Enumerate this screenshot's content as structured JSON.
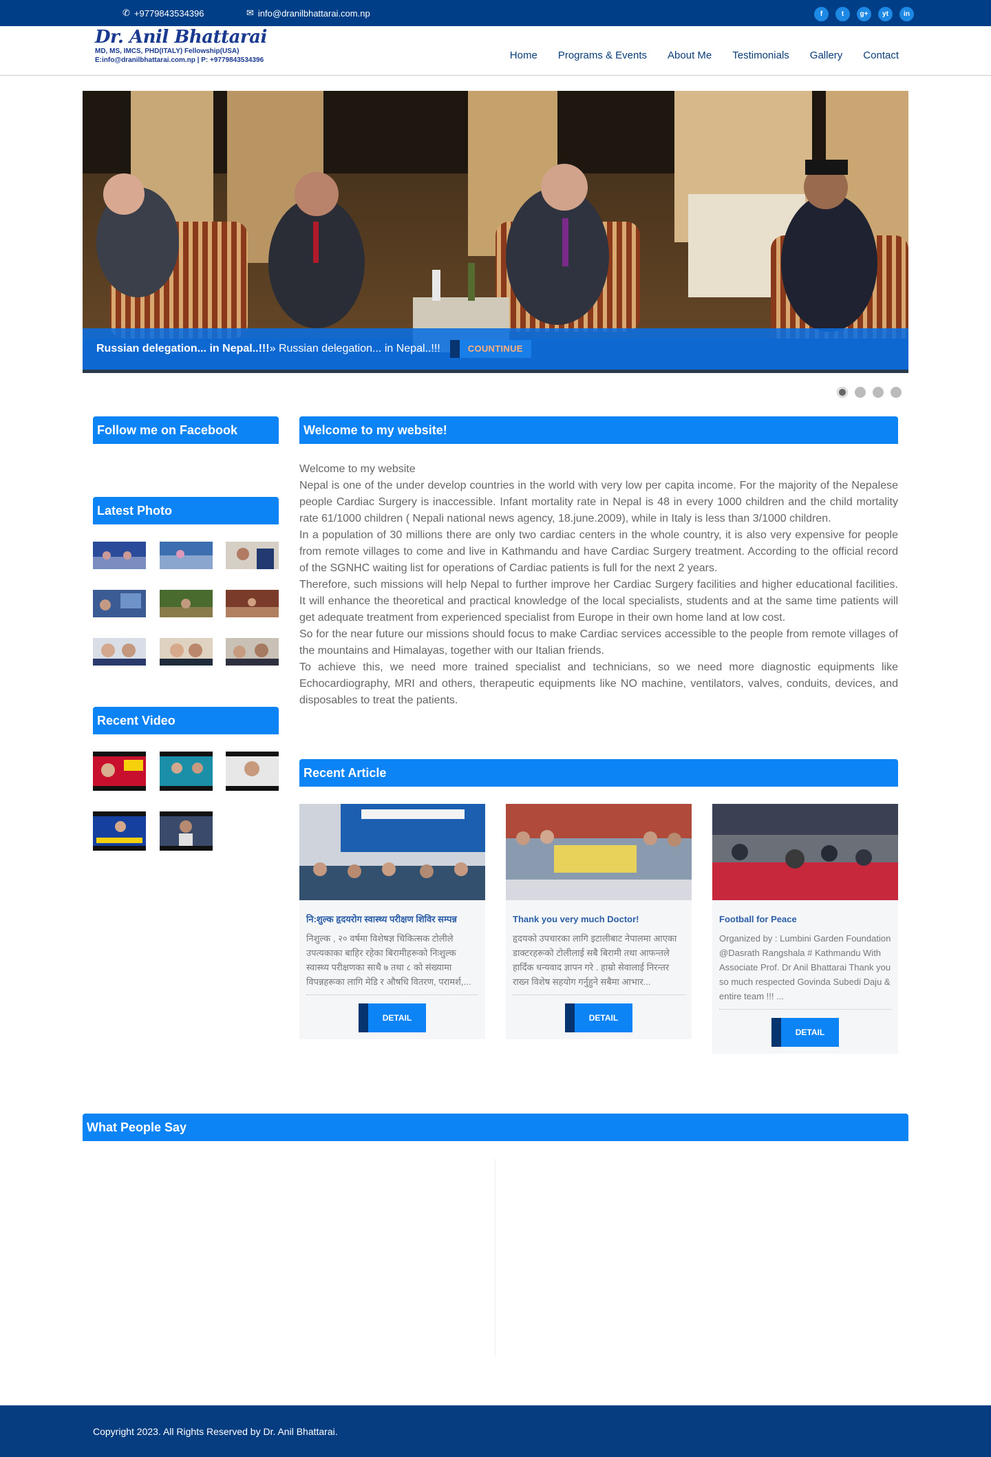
{
  "topbar": {
    "phone": "+9779843534396",
    "email": "info@dranilbhattarai.com.np",
    "social": [
      "f",
      "t",
      "g+",
      "yt",
      "in"
    ]
  },
  "logo": {
    "name": "Dr. Anil Bhattarai",
    "credentials": "MD, MS, IMCS, PHD(ITALY) Fellowship(USA)",
    "contact": "E:info@dranilbhattarai.com.np | P: +9779843534396"
  },
  "nav": {
    "items": [
      "Home",
      "Programs & Events",
      "About Me",
      "Testimonials",
      "Gallery",
      "Contact"
    ]
  },
  "slider": {
    "caption_title": "Russian delegation... in Nepal..!!!",
    "caption_text": "» Russian delegation... in Nepal..!!!",
    "button_label": "COUNTINUE",
    "slide_count": 4,
    "active_slide": 1
  },
  "sidebar": {
    "facebook_title": "Follow me on Facebook",
    "photo_title": "Latest Photo",
    "video_title": "Recent Video"
  },
  "welcome": {
    "title": "Welcome to my website!",
    "paragraphs": [
      "Welcome to my website",
      "Nepal is one of the under develop countries in the world with very low per capita income. For the majority of the Nepalese people Cardiac Surgery is inaccessible. Infant mortality rate in Nepal is 48 in every 1000 children and the child mortality rate 61/1000 children ( Nepali national news agency, 18.june.2009), while in Italy is less than 3/1000 children.",
      "In a population of 30 millions there are only two cardiac centers in the whole country, it is  also very expensive for people from remote villages to come and live in Kathmandu and have Cardiac Surgery treatment. According to the official record of the SGNHC waiting list for operations of Cardiac patients is full for the next 2 years.",
      "Therefore, such missions will help Nepal to further improve her Cardiac Surgery facilities and higher educational facilities. It will enhance the theoretical and practical knowledge of the local specialists, students and at the same time patients will get adequate treatment from experienced specialist from Europe in their own home land at low cost.",
      "So for the near future our missions should focus to make Cardiac services accessible to the people from remote villages of the mountains and Himalayas, together with our Italian friends.",
      "To achieve this, we need more trained specialist and technicians, so we need more diagnostic equipments like Echocardiography, MRI and others, therapeutic equipments like NO machine, ventilators, valves, conduits, devices, and disposables to treat the patients."
    ]
  },
  "articles": {
    "title": "Recent Article",
    "items": [
      {
        "title": "नि:शुल्क हृदयरोग स्वास्थ्य परीक्षण शिविर सम्पन्न",
        "body": "निशुल्क , २० वर्षमा  विशेषज्ञ चिकित्सक टोलीले उपत्यकाका बाहिर रहेका बिरामीहरूको निःशुल्क स्वास्थ्य परीक्षणका साथै ७ तथा ८ को संख्यामा विपन्नहरूका लागि मेडि र औषधि वितरण, परामर्श,...",
        "button": "DETAIL"
      },
      {
        "title": "Thank you very much Doctor!",
        "body": "हृदयको उपचारका लागि इटालीबाट नेपालमा आएका डाक्टरहरूको टोलीलाई सबै बिरामी तथा आफन्तले हार्दिक धन्यवाद ज्ञापन गरे . हाम्रो सेवालाई निरन्तर राख्न विशेष सहयोग गर्नुहुने सबैमा आभार...",
        "button": "DETAIL"
      },
      {
        "title": "Football for Peace",
        "body": "Organized by : Lumbini Garden Foundation @Dasrath Rangshala # Kathmandu With Associate Prof. Dr Anil Bhattarai Thank you so much respected Govinda Subedi Daju & entire team !!! ...",
        "button": "DETAIL"
      }
    ]
  },
  "testimonials": {
    "title": "What People Say"
  },
  "footer": {
    "copyright": "Copyright 2023. All Rights Reserved by Dr. Anil Bhattarai."
  }
}
